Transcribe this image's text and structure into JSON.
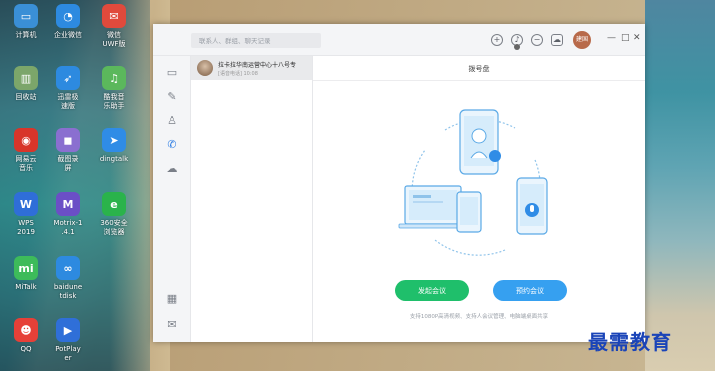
{
  "desktop": {
    "icons": [
      {
        "label": "计算机",
        "glyph": "▭",
        "color": "#3a8fd6"
      },
      {
        "label": "企业微信",
        "glyph": "◔",
        "color": "#2d8ae0"
      },
      {
        "label": "微信\nUWF版",
        "glyph": "✉",
        "color": "#e04a3c"
      },
      {
        "label": "回收站",
        "glyph": "▥",
        "color": "#7ca66a"
      },
      {
        "label": "迅雷极\n速版",
        "glyph": "➶",
        "color": "#2d8ae0"
      },
      {
        "label": "酷我音\n乐助手",
        "glyph": "♫",
        "color": "#5bb85c"
      },
      {
        "label": "网易云\n音乐",
        "glyph": "◉",
        "color": "#d8352a"
      },
      {
        "label": "截图录\n屏",
        "glyph": "◼",
        "color": "#8a6fd0"
      },
      {
        "label": "dingtalk",
        "glyph": "➤",
        "color": "#2f8ce6"
      },
      {
        "label": "WPS\n2019",
        "glyph": "W",
        "color": "#2f6ed8"
      },
      {
        "label": "Motrix-1\n.4.1",
        "glyph": "M",
        "color": "#6b4fc6"
      },
      {
        "label": "360安全\n浏览器",
        "glyph": "e",
        "color": "#2ab34b"
      },
      {
        "label": "MiTalk",
        "glyph": "mi",
        "color": "#3dbb5a"
      },
      {
        "label": "baidune\ntdisk",
        "glyph": "∞",
        "color": "#2d8ae0"
      },
      {
        "label": "QQ",
        "glyph": "☻",
        "color": "#e64038"
      },
      {
        "label": "PotPlay\ner",
        "glyph": "▶",
        "color": "#2f6fd8"
      }
    ]
  },
  "window": {
    "search_placeholder": "联系人、群组、聊天记录",
    "user_avatar_text": "建国",
    "controls": {
      "minimize": "—",
      "maximize": "□",
      "close": "✕"
    },
    "sidebar": [
      {
        "name": "chat",
        "glyph": "▭"
      },
      {
        "name": "pin",
        "glyph": "✎"
      },
      {
        "name": "contacts",
        "glyph": "♙"
      },
      {
        "name": "phone",
        "glyph": "✆"
      },
      {
        "name": "cloud",
        "glyph": "☁"
      },
      {
        "name": "apps",
        "glyph": "▦"
      },
      {
        "name": "mail",
        "glyph": "✉"
      }
    ],
    "conversation": {
      "name": "拉卡拉华南运营中心十八号专",
      "sub": "[语音电话] 10:08"
    },
    "main": {
      "title": "拨号盘",
      "start_meeting": "发起会议",
      "schedule_meeting": "预约会议",
      "footnote": "支持1080P高清视频、支持人会议管理、电脑端桌面共享"
    }
  },
  "watermark": "最需教育",
  "colors": {
    "accent_green": "#1fbf6b",
    "accent_blue": "#36a0f0",
    "active_icon": "#2a7be4"
  }
}
